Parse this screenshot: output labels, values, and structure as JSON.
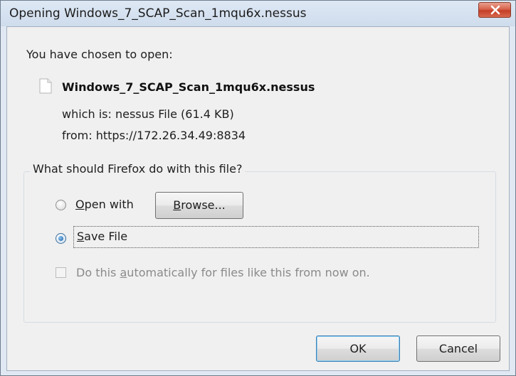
{
  "window": {
    "title": "Opening Windows_7_SCAP_Scan_1mqu6x.nessus"
  },
  "dialog": {
    "chosen_label": "You have chosen to open:",
    "file_name": "Windows_7_SCAP_Scan_1mqu6x.nessus",
    "which_is_label": "which is:",
    "which_is_value": "nessus File (61.4 KB)",
    "from_label": "from:",
    "from_value": "https://172.26.34.49:8834"
  },
  "action_group": {
    "label": "What should Firefox do with this file?",
    "open_with_label": "Open with",
    "open_with_selected": false,
    "browse_label": "Browse...",
    "save_file_label": "Save File",
    "save_file_selected": true,
    "auto_label": "Do this automatically for files like this from now on.",
    "auto_checked": false,
    "auto_enabled": false
  },
  "buttons": {
    "ok_label": "OK",
    "cancel_label": "Cancel"
  },
  "icons": {
    "close": "close-icon",
    "file": "file-icon"
  },
  "colors": {
    "close_button": "#c43f27",
    "title_bar": "#dde8f4",
    "client_bg": "#f0f0f0",
    "default_button_border": "#3c7fb1"
  }
}
